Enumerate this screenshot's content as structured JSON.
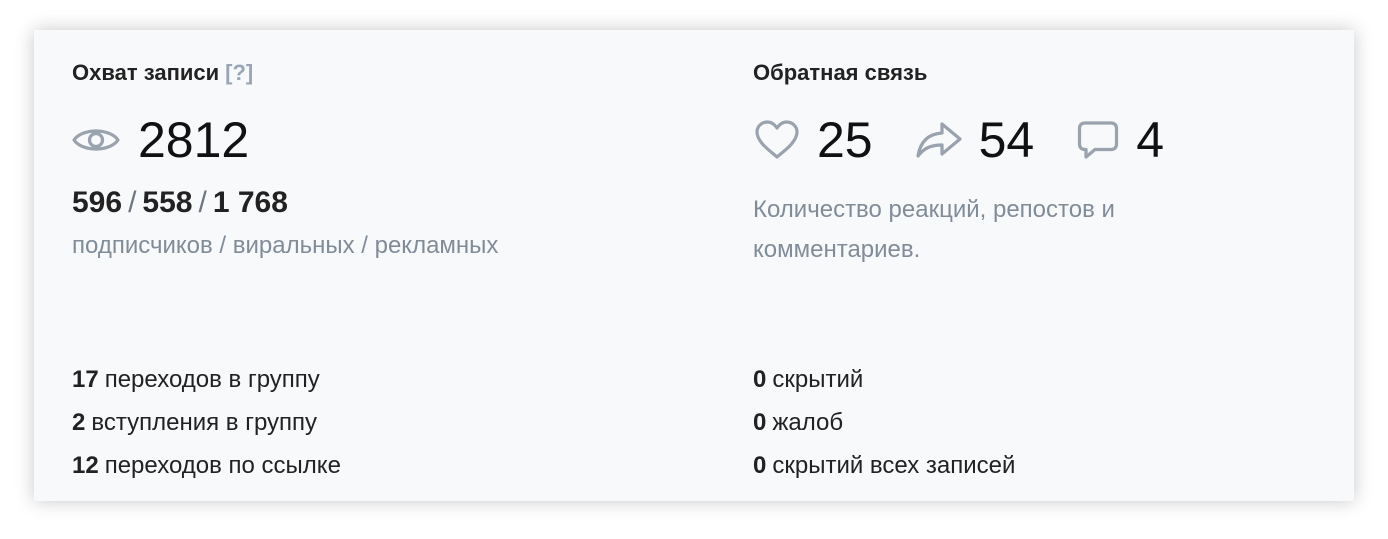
{
  "reach": {
    "title": "Охват записи",
    "help": "[?]",
    "views": "2812",
    "subscribers": "596",
    "viral": "558",
    "ads": "1 768",
    "separator": "/",
    "subtitle": "подписчиков / виральных / рекламных",
    "stats": [
      {
        "value": "17",
        "label": "переходов в группу"
      },
      {
        "value": "2",
        "label": "вступления в группу"
      },
      {
        "value": "12",
        "label": "переходов по ссылке"
      }
    ]
  },
  "feedback": {
    "title": "Обратная связь",
    "likes": "25",
    "reposts": "54",
    "comments": "4",
    "description": "Количество реакций, репостов и комментариев.",
    "stats": [
      {
        "value": "0",
        "label": "скрытий"
      },
      {
        "value": "0",
        "label": "жалоб"
      },
      {
        "value": "0",
        "label": "скрытий всех записей"
      }
    ]
  },
  "colors": {
    "icon": "#99a2ad",
    "muted_text": "#818c99",
    "card_background": "#f8f9fb"
  },
  "icons": {
    "views": "eye-icon",
    "likes": "heart-icon",
    "reposts": "share-arrow-icon",
    "comments": "comment-bubble-icon"
  }
}
